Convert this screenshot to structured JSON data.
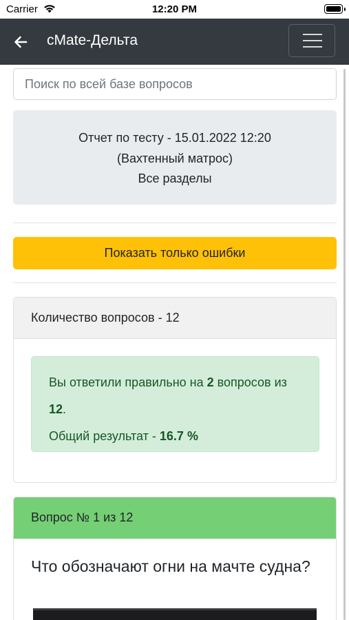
{
  "status_bar": {
    "carrier": "Carrier",
    "time": "12:20 PM"
  },
  "navbar": {
    "title": "сMate-Дельта",
    "back_icon": "arrow-left-icon",
    "menu_icon": "hamburger-menu-icon",
    "background_color": "#343a40"
  },
  "search": {
    "placeholder": "Поиск по всей базе вопросов",
    "value": ""
  },
  "report": {
    "line1": "Отчет по тесту - 15.01.2022 12:20",
    "line2": "(Вахтенный матрос)",
    "line3": "Все разделы"
  },
  "errors_button": {
    "label": "Показать только ошибки",
    "color": "#ffc107"
  },
  "summary_card": {
    "header": "Количество вопросов - 12",
    "result_prefix": "Вы ответили правильно на",
    "correct_count": "2",
    "result_middle": "вопросов из",
    "total_count": "12",
    "result_suffix": ".",
    "overall_label": "Общий результат -",
    "overall_value": "16.7 %",
    "alert_color": "#d4edda"
  },
  "question_card": {
    "header": "Вопрос № 1 из 12",
    "question": "Что обозначают огни на мачте судна?",
    "header_color": "#75cf75"
  }
}
